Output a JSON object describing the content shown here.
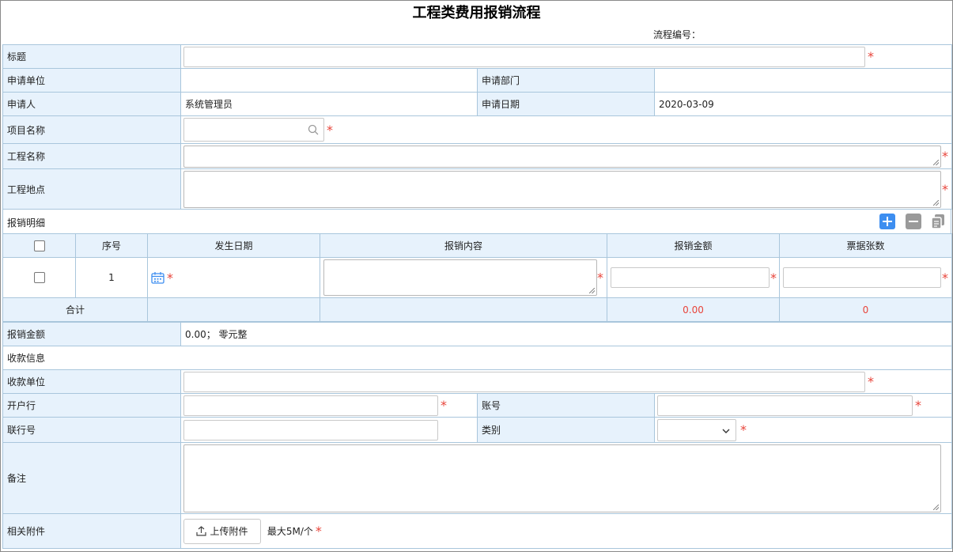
{
  "header": {
    "title": "工程类费用报销流程",
    "flow_number_label": "流程编号："
  },
  "form": {
    "title_label": "标题",
    "applicant_unit_label": "申请单位",
    "applicant_dept_label": "申请部门",
    "applicant_label": "申请人",
    "applicant_value": "系统管理员",
    "apply_date_label": "申请日期",
    "apply_date_value": "2020-03-09",
    "project_name_label": "项目名称",
    "engineering_name_label": "工程名称",
    "engineering_location_label": "工程地点"
  },
  "detail": {
    "section_label": "报销明细",
    "columns": [
      "序号",
      "发生日期",
      "报销内容",
      "报销金额",
      "票据张数"
    ],
    "rows": [
      {
        "seq": "1"
      }
    ],
    "total_label": "合计",
    "total_amount": "0.00",
    "total_count": "0"
  },
  "summary": {
    "amount_label": "报销金额",
    "amount_value": "0.00；  零元整",
    "payee_section_label": "收款信息",
    "payee_unit_label": "收款单位",
    "bank_label": "开户行",
    "account_label": "账号",
    "bank_code_label": "联行号",
    "category_label": "类别",
    "remark_label": "备注",
    "attachment_label": "相关附件",
    "upload_button_label": "上传附件",
    "upload_hint": "最大5M/个"
  },
  "colors": {
    "label_bg": "#e7f2fc",
    "border": "#a9c6dc",
    "required": "#e8443a",
    "add_button": "#3d8ef0"
  }
}
